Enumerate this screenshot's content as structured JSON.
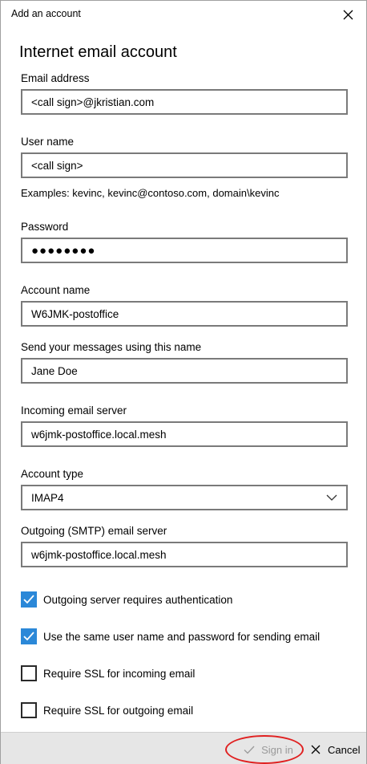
{
  "window": {
    "title": "Add an account",
    "heading": "Internet email account"
  },
  "fields": {
    "email": {
      "label": "Email address",
      "value": "<call sign>@jkristian.com"
    },
    "username": {
      "label": "User name",
      "value": "<call sign>",
      "hint": "Examples: kevinc, kevinc@contoso.com, domain\\kevinc"
    },
    "password": {
      "label": "Password",
      "value": "●●●●●●●●"
    },
    "account_name": {
      "label": "Account name",
      "value": "W6JMK-postoffice"
    },
    "display_name": {
      "label": "Send your messages using this name",
      "value": "Jane Doe"
    },
    "incoming_server": {
      "label": "Incoming email server",
      "value": "w6jmk-postoffice.local.mesh"
    },
    "account_type": {
      "label": "Account type",
      "value": "IMAP4"
    },
    "outgoing_server": {
      "label": "Outgoing (SMTP) email server",
      "value": "w6jmk-postoffice.local.mesh"
    }
  },
  "options": [
    {
      "label": "Outgoing server requires authentication",
      "checked": true
    },
    {
      "label": "Use the same user name and password for sending email",
      "checked": true
    },
    {
      "label": "Require SSL for incoming email",
      "checked": false
    },
    {
      "label": "Require SSL for outgoing email",
      "checked": false
    }
  ],
  "footer": {
    "sign_in_label": "Sign in",
    "cancel_label": "Cancel"
  },
  "colors": {
    "accent": "#2b88d8",
    "annotation_ring": "#e02020",
    "footer_bg": "#e6e6e6"
  }
}
